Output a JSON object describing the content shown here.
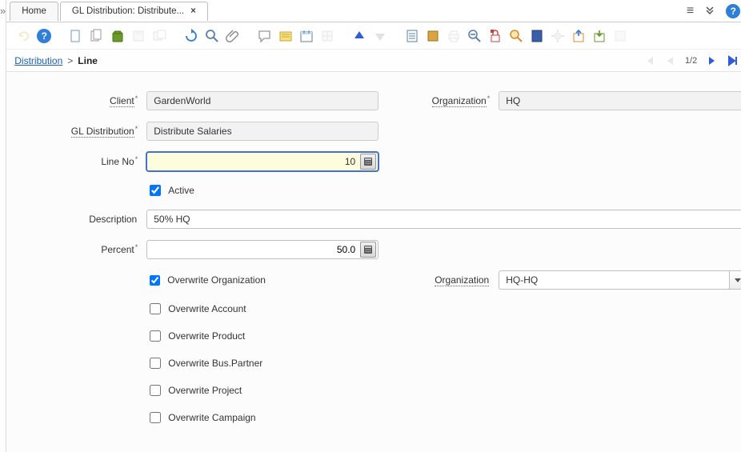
{
  "tabs": {
    "home": "Home",
    "active": "GL Distribution: Distribute..."
  },
  "breadcrumb": {
    "parent": "Distribution",
    "sep": ">",
    "current": "Line"
  },
  "pager": {
    "text": "1/2"
  },
  "labels": {
    "client": "Client",
    "organization": "Organization",
    "gl_distribution": "GL Distribution",
    "line_no": "Line No",
    "description": "Description",
    "percent": "Percent",
    "ov_org_chk": "Overwrite Organization",
    "organization2": "Organization",
    "ov_account": "Overwrite Account",
    "ov_product": "Overwrite Product",
    "ov_bpartner": "Overwrite Bus.Partner",
    "ov_project": "Overwrite Project",
    "ov_campaign": "Overwrite Campaign",
    "active": "Active"
  },
  "values": {
    "client": "GardenWorld",
    "organization": "HQ",
    "gl_distribution": "Distribute Salaries",
    "line_no": "10",
    "active_checked": true,
    "description": "50% HQ",
    "percent": "50.0",
    "ov_org_checked": true,
    "organization2": "HQ-HQ",
    "ov_account_checked": false,
    "ov_product_checked": false,
    "ov_bpartner_checked": false,
    "ov_project_checked": false,
    "ov_campaign_checked": false
  }
}
